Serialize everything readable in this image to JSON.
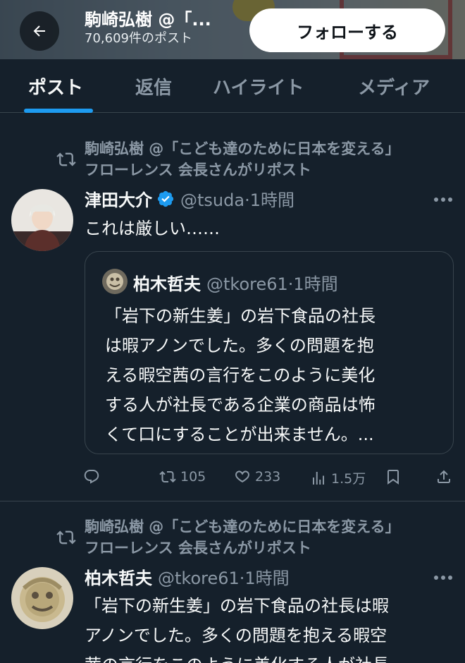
{
  "header": {
    "profile_name": "駒崎弘樹 @「...",
    "post_count": "70,609件のポスト",
    "follow_label": "フォローする"
  },
  "tabs": [
    {
      "label": "ポスト",
      "active": true
    },
    {
      "label": "返信",
      "active": false
    },
    {
      "label": "ハイライト",
      "active": false
    },
    {
      "label": "メディア",
      "active": false
    }
  ],
  "posts": [
    {
      "repost_line1": "駒崎弘樹 @「こども達のために日本を変える」",
      "repost_line2": "フローレンス 会長さんがリポスト",
      "author_name": "津田大介",
      "verified": true,
      "handle_time": "@tsuda·1時間",
      "text": "これは厳しい……",
      "quote": {
        "author_name": "柏木哲夫",
        "handle_time": "@tkore61·1時間",
        "lines": [
          "「岩下の新生姜」の岩下食品の社長",
          "は暇アノンでした。多くの問題を抱",
          "える暇空茜の言行をこのように美化",
          "する人が社長である企業の商品は怖",
          "くて口にすることが出来ません。..."
        ]
      },
      "actions": {
        "reply_count": "",
        "repost_count": "105",
        "like_count": "233",
        "view_count": "1.5万"
      }
    },
    {
      "repost_line1": "駒崎弘樹 @「こども達のために日本を変える」",
      "repost_line2": "フローレンス 会長さんがリポスト",
      "author_name": "柏木哲夫",
      "verified": false,
      "handle_time": "@tkore61·1時間",
      "lines": [
        "「岩下の新生姜」の岩下食品の社長は暇",
        "アノンでした。多くの問題を抱える暇空",
        "茜の言行をこのように美化する人が社長"
      ]
    }
  ],
  "colors": {
    "background": "#15202b",
    "accent": "#1d9bf0",
    "secondary_text": "#8b98a5",
    "border": "#38444d"
  }
}
